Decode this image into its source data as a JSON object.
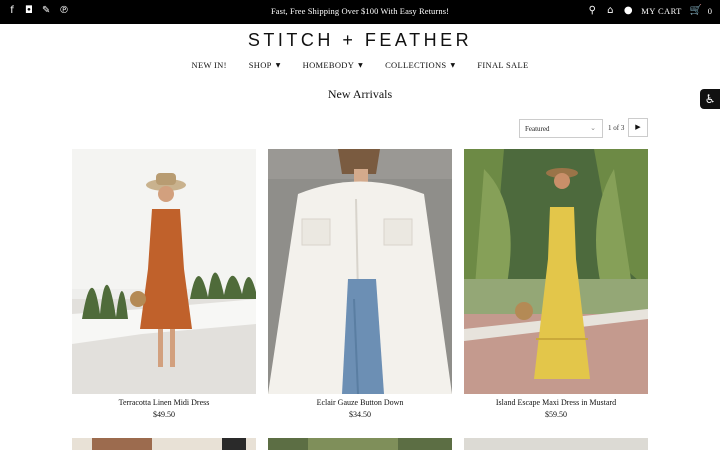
{
  "topbar": {
    "announcement": "Fast, Free Shipping Over $100 With Easy Returns!",
    "social_icons": [
      "facebook-icon",
      "instagram-icon",
      "twitter-icon",
      "pinterest-icon"
    ],
    "cart_label": "MY CART",
    "cart_count": "0",
    "colors": {
      "background": "#000000",
      "text": "#ffffff"
    }
  },
  "brand": {
    "logo": "STITCH + FEATHER"
  },
  "nav": {
    "items": [
      {
        "label": "NEW IN!",
        "dropdown": false
      },
      {
        "label": "SHOP",
        "dropdown": true
      },
      {
        "label": "HOMEBODY",
        "dropdown": true
      },
      {
        "label": "COLLECTIONS",
        "dropdown": true
      },
      {
        "label": "FINAL SALE",
        "dropdown": false
      }
    ]
  },
  "page": {
    "title": "New Arrivals"
  },
  "toolbar": {
    "sort_selected": "Featured",
    "pagination": "1 of 3"
  },
  "products": [
    {
      "name": "Terracotta Linen Midi Dress",
      "price": "$49.50",
      "dress_color": "#c0612b"
    },
    {
      "name": "Eclair Gauze Button Down",
      "price": "$34.50",
      "dress_color": "#f3f1ec"
    },
    {
      "name": "Island Escape Maxi Dress in Mustard",
      "price": "$59.50",
      "dress_color": "#e3c64a"
    }
  ]
}
